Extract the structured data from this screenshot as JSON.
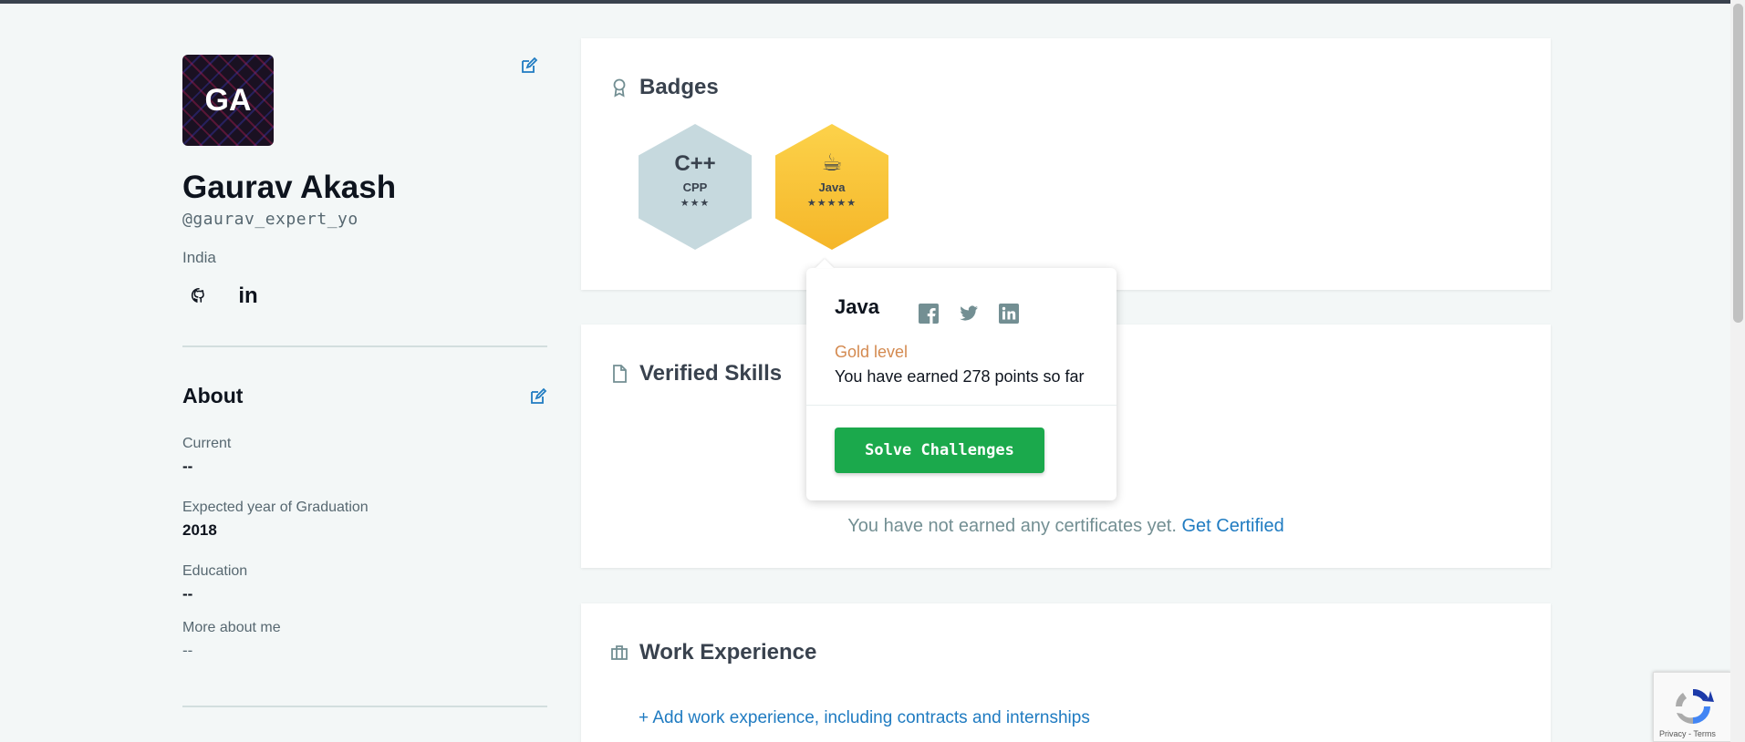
{
  "profile": {
    "avatar_initials": "GA",
    "name": "Gaurav Akash",
    "handle": "@gaurav_expert_yo",
    "country": "India",
    "socials": [
      "github-icon",
      "linkedin-icon"
    ]
  },
  "about": {
    "title": "About",
    "fields": [
      {
        "label": "Current",
        "value": "--"
      },
      {
        "label": "Expected year of Graduation",
        "value": "2018"
      },
      {
        "label": "Education",
        "value": "--"
      },
      {
        "label": "More about me",
        "value": "--"
      }
    ]
  },
  "badges": {
    "title": "Badges",
    "items": [
      {
        "name": "CPP",
        "icon_text": "C++",
        "stars": "★★★",
        "star_count": 3,
        "color": "#c6d9de"
      },
      {
        "name": "Java",
        "icon_text": "☕",
        "stars": "★★★★★",
        "star_count": 5,
        "color": "#f7c12b"
      }
    ]
  },
  "popover": {
    "title": "Java",
    "level": "Gold level",
    "points_text": "You have earned 278 points so far",
    "button_label": "Solve Challenges",
    "share_icons": [
      "facebook-icon",
      "twitter-icon",
      "linkedin-icon"
    ]
  },
  "verified_skills": {
    "title": "Verified Skills",
    "empty_text": "You have not earned any certificates yet.",
    "link_text": "Get Certified"
  },
  "work_experience": {
    "title": "Work Experience",
    "add_link": "+ Add work experience, including contracts and internships"
  },
  "recaptcha": {
    "text": "Privacy - Terms"
  },
  "colors": {
    "accent_blue": "#1f7bc1",
    "button_green": "#1ba94c",
    "gold": "#f7c12b",
    "level_orange": "#d48a50"
  }
}
